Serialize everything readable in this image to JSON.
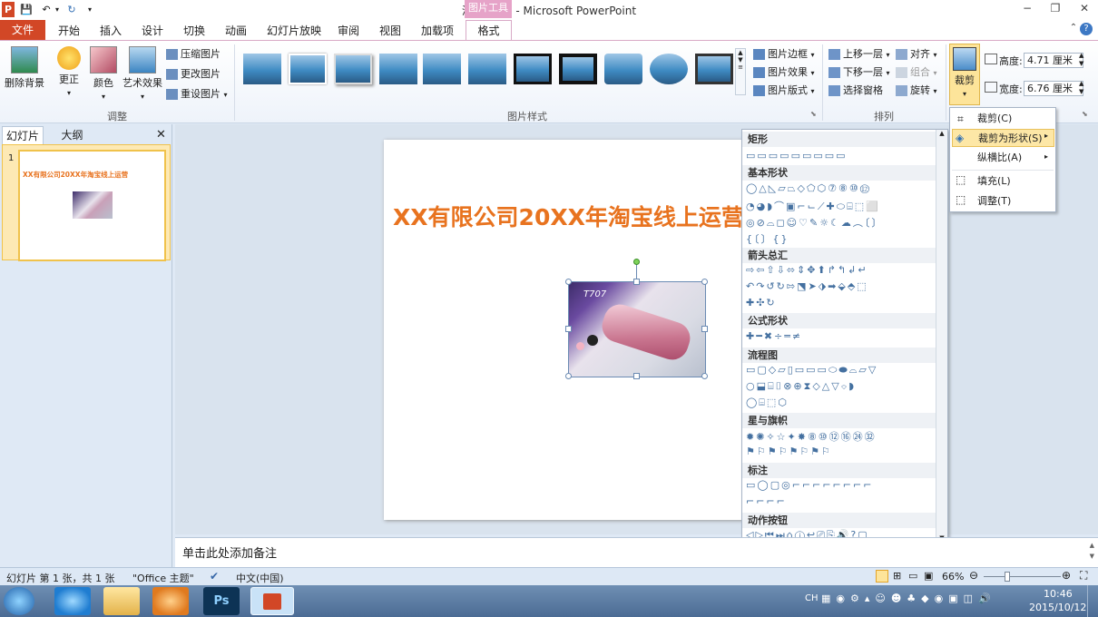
{
  "window": {
    "title": "演示文稿1 - Microsoft PowerPoint",
    "context_tab": "图片工具",
    "qat_app": "P"
  },
  "tabs": [
    "文件",
    "开始",
    "插入",
    "设计",
    "切换",
    "动画",
    "幻灯片放映",
    "审阅",
    "视图",
    "加载项",
    "格式"
  ],
  "ribbon": {
    "remove_bg": "删除背景",
    "adjust": {
      "corrections": "更正",
      "color": "颜色",
      "artistic": "艺术效果",
      "compress": "压缩图片",
      "change": "更改图片",
      "reset": "重设图片",
      "label": "调整"
    },
    "styles": {
      "label": "图片样式",
      "border": "图片边框",
      "effects": "图片效果",
      "layout": "图片版式"
    },
    "arrange": {
      "label": "排列",
      "bring_forward": "上移一层",
      "send_backward": "下移一层",
      "selection_pane": "选择窗格",
      "align": "对齐",
      "group": "组合",
      "rotate": "旋转"
    },
    "size": {
      "crop": "裁剪",
      "height_label": "高度:",
      "height_value": "4.71 厘米",
      "width_label": "宽度:",
      "width_value": "6.76 厘米"
    }
  },
  "left_pane": {
    "tab_slides": "幻灯片",
    "tab_outline": "大纲",
    "slide_number": "1",
    "thumb_title": "XX有限公司20XX年淘宝线上运营"
  },
  "slide": {
    "title": "XX有限公司20XX年淘宝线上运营",
    "photo_text": "T707"
  },
  "shapes_menu": {
    "sections": [
      {
        "name": "矩形",
        "rows": [
          "▭▭▭▭▭▭▭▭▭"
        ]
      },
      {
        "name": "基本形状",
        "rows": [
          "◯△◺▱⏢◇⬠⬡⑦⑧⑩⑫",
          "◔◕◗⌒▣⌐⌙⟋✚⬭⌸⬚⬜",
          "◎⊘⌓◻☺♡✎☼☾☁︵〔〕",
          "{〔〕{}"
        ]
      },
      {
        "name": "箭头总汇",
        "rows": [
          "⇨⇦⇧⇩⬄⇕✥⬆↱↰↲↵",
          "↶↷↺↻⇰⬔➤⬗➡⬙⬘⬚",
          "✚✣↻"
        ]
      },
      {
        "name": "公式形状",
        "rows": [
          "✚━✖÷═≠"
        ]
      },
      {
        "name": "流程图",
        "rows": [
          "▭▢◇▱▯▭▭▭⬭⬬⌓▱▽",
          "○⬓⌸⌷⊗⊕⧗◇△▽⌔◗",
          "◯⌸⬚⬡"
        ]
      },
      {
        "name": "星与旗帜",
        "rows": [
          "✹✺✧☆✦✸⑧⑩⑫⑯㉔㉜",
          "⚑⚐⚑⚐⚑⚐⚑⚐"
        ]
      },
      {
        "name": "标注",
        "rows": [
          "▭◯▢◎⌐⌐⌐⌐⌐⌐⌐⌐",
          "⌐⌐⌐⌐"
        ]
      },
      {
        "name": "动作按钮",
        "rows": [
          "◁▷⏮⏭⌂ⓘ↩⎚⎘🔊?▢"
        ]
      }
    ]
  },
  "crop_menu": {
    "items": [
      "裁剪(C)",
      "裁剪为形状(S)",
      "纵横比(A)",
      "填充(L)",
      "调整(T)"
    ]
  },
  "notes": {
    "placeholder": "单击此处添加备注"
  },
  "status": {
    "slide_info": "幻灯片 第 1 张，共 1 张",
    "theme": "\"Office 主题\"",
    "language": "中文(中国)",
    "zoom": "66%"
  },
  "taskbar": {
    "input_method": "CH",
    "time": "10:46",
    "date": "2015/10/12"
  }
}
